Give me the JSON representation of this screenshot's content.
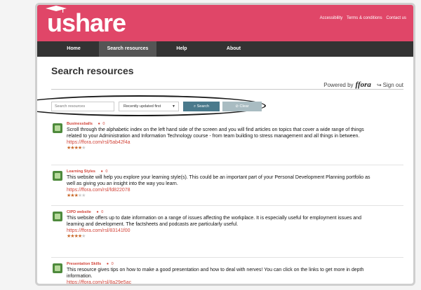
{
  "header": {
    "logo": "ushare"
  },
  "toplinks": [
    "Accessibility",
    "Terms & conditions",
    "Contact us"
  ],
  "nav": [
    "Home",
    "Search resources",
    "Help",
    "About"
  ],
  "page": {
    "title": "Search resources"
  },
  "powered": {
    "label": "Powered by",
    "brand": "ffora",
    "signout": "Sign out"
  },
  "search": {
    "placeholder": "Search resources",
    "sort_value": "Recently updated first",
    "search_label": "Search",
    "clear_label": "Clear"
  },
  "colors": {
    "brand_pink": "#e04668",
    "nav_dark": "#333333",
    "accent_red": "#d2453a",
    "button_blue": "#4a7a8c"
  },
  "resources": [
    {
      "title": "Businessballs",
      "comments": "0",
      "description": "Scroll through the alphabetic index on the left hand side of the screen and you will find articles on topics that cover a wide range of things related to your Administration and Information Technology course - from team building to stress management and all things in between.",
      "link": "https://ffora.com/rsl/5ab42f4a",
      "rating": 4
    },
    {
      "title": "Learning Styles",
      "comments": "0",
      "description": "This website will help you explore your learning style(s). This could be an important part of your Personal Development Planning portfolio as well as giving you an insight into the way you learn.",
      "link": "https://ffora.com/rsl/fd822078",
      "rating": 3
    },
    {
      "title": "CIPD website",
      "comments": "0",
      "description": "This website offers up to date information on a range of issues affecting the workplace. It is especially useful for employment issues and learning and development. The factsheets and podcasts are particularly useful.",
      "link": "https://ffora.com/rsl/83141f00",
      "rating": 4
    },
    {
      "title": "Presentation Skills",
      "comments": "0",
      "description": "This resource gives tips on how to make a good presentation and how to deal with nerves! You can click on the links to get more in depth information.",
      "link": "https://ffora.com/rsl/8a29e5ac",
      "rating": 0
    }
  ]
}
